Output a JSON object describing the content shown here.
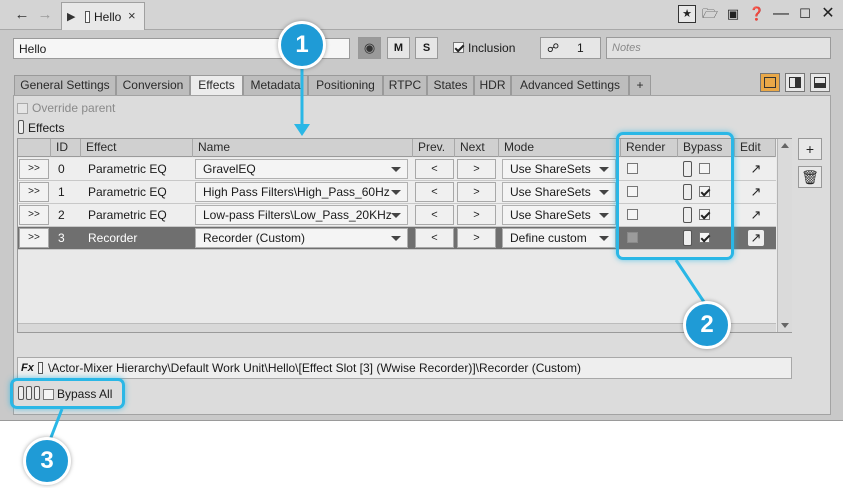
{
  "titlebar": {
    "back_icon": "arrow-left-icon",
    "forward_icon": "arrow-right-icon",
    "tab_title": "Hello",
    "tab_close": "×",
    "window_icons": [
      "star-icon",
      "folder-icon",
      "save-icon",
      "help-icon",
      "minimize-icon",
      "maximize-icon",
      "close-icon"
    ]
  },
  "object": {
    "name": "Hello",
    "mute_label": "M",
    "solo_label": "S",
    "inclusion_label": "Inclusion",
    "inclusion_checked": true,
    "share_count": "1",
    "notes_placeholder": "Notes"
  },
  "tabs": [
    {
      "label": "General Settings",
      "active": false
    },
    {
      "label": "Conversion",
      "active": false
    },
    {
      "label": "Effects",
      "active": true
    },
    {
      "label": "Metadata",
      "active": false
    },
    {
      "label": "Positioning",
      "active": false
    },
    {
      "label": "RTPC",
      "active": false
    },
    {
      "label": "States",
      "active": false
    },
    {
      "label": "HDR",
      "active": false
    },
    {
      "label": "Advanced Settings",
      "active": false
    },
    {
      "label": "+",
      "active": false
    }
  ],
  "effects": {
    "override_parent_label": "Override parent",
    "section_label": "Effects",
    "columns": {
      "id": "ID",
      "effect": "Effect",
      "name": "Name",
      "prev": "Prev.",
      "next": "Next",
      "mode": "Mode",
      "render": "Render",
      "bypass": "Bypass",
      "edit": "Edit"
    },
    "expand_label": ">>",
    "prev_label": "<",
    "next_label": ">",
    "rows": [
      {
        "id": "0",
        "effect": "Parametric EQ",
        "name": "GravelEQ",
        "mode": "Use ShareSets",
        "render": false,
        "bypass": false,
        "selected": false
      },
      {
        "id": "1",
        "effect": "Parametric EQ",
        "name": "High Pass Filters\\High_Pass_60Hz",
        "mode": "Use ShareSets",
        "render": false,
        "bypass": true,
        "selected": false
      },
      {
        "id": "2",
        "effect": "Parametric EQ",
        "name": "Low-pass Filters\\Low_Pass_20KHz",
        "mode": "Use ShareSets",
        "render": false,
        "bypass": true,
        "selected": false
      },
      {
        "id": "3",
        "effect": "Recorder",
        "name": "Recorder (Custom)",
        "mode": "Define custom",
        "render": false,
        "bypass": true,
        "selected": true
      }
    ],
    "path": "\\Actor-Mixer Hierarchy\\Default Work Unit\\Hello\\[Effect Slot [3] (Wwise Recorder)]\\Recorder (Custom)",
    "fx_label": "Fx",
    "bypass_all_label": "Bypass All",
    "bypass_all_checked": false
  },
  "callouts": [
    "1",
    "2",
    "3"
  ],
  "colors": {
    "callout": "#1f9bd6",
    "selected_row": "#6f6f6f",
    "active_layout": "#e9a848"
  }
}
